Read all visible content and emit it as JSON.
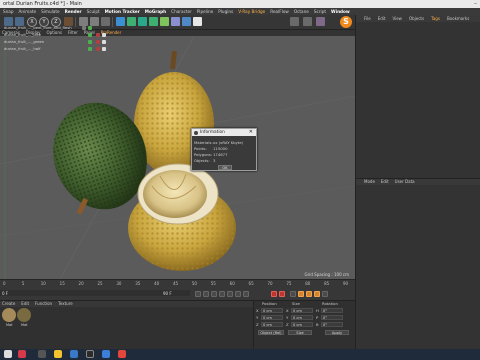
{
  "window": {
    "title": "ortal Durian Fruits.c4d *] - Main",
    "minimize": "–"
  },
  "menubar": {
    "items": [
      {
        "label": "Snap",
        "style": "normal"
      },
      {
        "label": "Animate",
        "style": "normal"
      },
      {
        "label": "Simulate",
        "style": "normal"
      },
      {
        "label": "Render",
        "style": "hl"
      },
      {
        "label": "Sculpt",
        "style": "normal"
      },
      {
        "label": "Motion Tracker",
        "style": "hl"
      },
      {
        "label": "MoGraph",
        "style": "hl"
      },
      {
        "label": "Character",
        "style": "normal"
      },
      {
        "label": "Pipeline",
        "style": "normal"
      },
      {
        "label": "Plugins",
        "style": "normal"
      },
      {
        "label": "V-Ray Bridge",
        "style": "acc"
      },
      {
        "label": "RealFlow",
        "style": "normal"
      },
      {
        "label": "Octane",
        "style": "normal"
      },
      {
        "label": "Script",
        "style": "normal"
      },
      {
        "label": "Window",
        "style": "hl"
      },
      {
        "label": "Help",
        "style": "hl"
      }
    ]
  },
  "toolbar": {
    "axis_x": "X",
    "axis_y": "Y",
    "axis_z": "Z",
    "logo": "S"
  },
  "viewport_menu": {
    "items": [
      "Cameras",
      "Display",
      "Options",
      "Filter",
      "Panel",
      "ProRender"
    ],
    "active_index": 5
  },
  "viewport": {
    "grid_spacing": "Grid Spacing : 100 cm"
  },
  "info_dialog": {
    "title": "Information",
    "rows": [
      {
        "label": "Materials:",
        "value": "xx (xRAY Kbyte)"
      },
      {
        "label": "Points:",
        "value": "115000"
      },
      {
        "label": "Polygons:",
        "value": "174677"
      },
      {
        "label": "Objects:",
        "value": "3"
      }
    ],
    "ok_label": "OK"
  },
  "object_manager": {
    "tabs": [
      "File",
      "Edit",
      "View",
      "Objects",
      "Tags",
      "Bookmarks"
    ],
    "active_tab_index": 4,
    "objects": [
      {
        "name": "durian_fruit_..._peel_core_and_flesh"
      },
      {
        "name": "durian_fruit_..._tree"
      },
      {
        "name": "durian_fruit_..._green"
      },
      {
        "name": "durian_fruit_..._half"
      }
    ]
  },
  "attribute_manager": {
    "tabs": [
      "Mode",
      "Edit",
      "User Data"
    ]
  },
  "timeline": {
    "ticks": [
      "0",
      "5",
      "10",
      "15",
      "20",
      "25",
      "30",
      "35",
      "40",
      "45",
      "50",
      "55",
      "60",
      "65",
      "70",
      "75",
      "80",
      "85",
      "90"
    ],
    "start_frame": "0 F",
    "end_frame": "90 F"
  },
  "materials": {
    "tabs": [
      "Create",
      "Edit",
      "Function",
      "Texture"
    ],
    "items": [
      {
        "label": "Mat",
        "color": "#a58a5a"
      },
      {
        "label": "Mat",
        "color": "#7a6a40"
      }
    ]
  },
  "coordinates": {
    "headers": [
      "Position",
      "Size",
      "Rotation"
    ],
    "rows": [
      {
        "axis": "X",
        "pos": "0 cm",
        "size": "0 cm",
        "rot_axis": "H",
        "rot": "0°"
      },
      {
        "axis": "Y",
        "pos": "0 cm",
        "size": "0 cm",
        "rot_axis": "P",
        "rot": "0°"
      },
      {
        "axis": "Z",
        "pos": "0 cm",
        "size": "0 cm",
        "rot_axis": "B",
        "rot": "0°"
      }
    ],
    "mode_object": "Object (Rel)",
    "mode_size": "Size",
    "apply": "Apply"
  },
  "colors": {
    "viewport_bg": "#5b5b5b",
    "accent": "#ffb048",
    "logo": "#f08a1c",
    "record": "#c3332b"
  }
}
